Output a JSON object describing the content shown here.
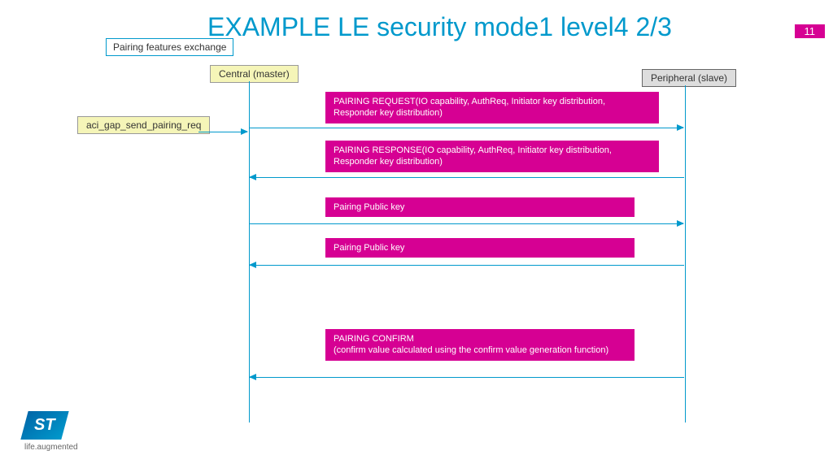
{
  "title": "EXAMPLE LE security mode1 level4 2/3",
  "page_number": "11",
  "labels": {
    "pairing_features": "Pairing features exchange",
    "central": "Central (master)",
    "peripheral": "Peripheral (slave)",
    "api_call": "aci_gap_send_pairing_req"
  },
  "messages": {
    "pairing_request": "PAIRING REQUEST(IO capability, AuthReq, Initiator key distribution, Responder key distribution)",
    "pairing_response": "PAIRING RESPONSE(IO capability, AuthReq, Initiator key distribution, Responder key distribution)",
    "public_key_1": "Pairing Public key",
    "public_key_2": "Pairing Public key",
    "pairing_confirm": "PAIRING CONFIRM\n(confirm value  calculated using the confirm value generation function)"
  },
  "logo": {
    "text": "ST",
    "tagline": "life.augmented"
  }
}
